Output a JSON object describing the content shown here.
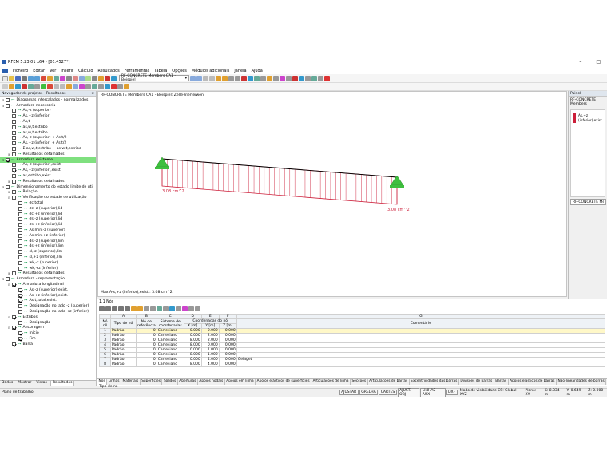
{
  "window": {
    "title": "RFEM 5.23.01 x64 - [01.4527*]"
  },
  "menu": [
    "Ficheiro",
    "Editar",
    "Ver",
    "Inserir",
    "Cálculo",
    "Resultados",
    "Ferramentas",
    "Tabela",
    "Opções",
    "Módulos adicionais",
    "Janela",
    "Ajuda"
  ],
  "toolbar": {
    "module_combo": "RF-CONCRETE Members CA1 - Beispiel"
  },
  "navigator": {
    "title": "Navegador de projetos - Resultados",
    "items": [
      {
        "level": 0,
        "toggle": "⊟",
        "checked": false,
        "label": "Diagramas intercalados - normalizados"
      },
      {
        "level": 0,
        "toggle": "⊟",
        "checked": false,
        "label": "Armadura necessária"
      },
      {
        "level": 1,
        "toggle": "",
        "checked": false,
        "label": "As,-z (superior)"
      },
      {
        "level": 1,
        "toggle": "",
        "checked": false,
        "label": "As,+z (inferior)"
      },
      {
        "level": 1,
        "toggle": "",
        "checked": false,
        "label": "As,t"
      },
      {
        "level": 1,
        "toggle": "",
        "checked": false,
        "label": "as,w,t,estribo"
      },
      {
        "level": 1,
        "toggle": "",
        "checked": false,
        "label": "as,w,t,estribo"
      },
      {
        "level": 1,
        "toggle": "",
        "checked": false,
        "label": "As,-z (superior) + As,t/2"
      },
      {
        "level": 1,
        "toggle": "",
        "checked": false,
        "label": "As,+z (inferior) + As,t/2"
      },
      {
        "level": 1,
        "toggle": "",
        "checked": false,
        "label": "Σ as,w,t,estribo + as,w,t,estribo"
      },
      {
        "level": 1,
        "toggle": "⊞",
        "checked": false,
        "label": "Resultados detalhados"
      },
      {
        "level": 0,
        "toggle": "⊟",
        "checked": true,
        "label": "Armadura existente",
        "highlight": true
      },
      {
        "level": 1,
        "toggle": "",
        "checked": false,
        "label": "As,-z (superior),exist."
      },
      {
        "level": 1,
        "toggle": "",
        "checked": true,
        "label": "As,+z (inferior),exist."
      },
      {
        "level": 1,
        "toggle": "",
        "checked": false,
        "label": "as,estribo,exist."
      },
      {
        "level": 1,
        "toggle": "⊞",
        "checked": false,
        "label": "Resultados detalhados"
      },
      {
        "level": 0,
        "toggle": "⊟",
        "checked": false,
        "label": "Dimensionamento do estado limite de uti"
      },
      {
        "level": 1,
        "toggle": "⊞",
        "checked": false,
        "label": "Relação"
      },
      {
        "level": 1,
        "toggle": "⊟",
        "checked": false,
        "label": "Verificação do estado de utilização"
      },
      {
        "level": 2,
        "toggle": "",
        "checked": false,
        "label": "σc,total"
      },
      {
        "level": 2,
        "toggle": "",
        "checked": false,
        "label": "σc,-z (superior),lid"
      },
      {
        "level": 2,
        "toggle": "",
        "checked": false,
        "label": "σc,+z (inferior),lid"
      },
      {
        "level": 2,
        "toggle": "",
        "checked": false,
        "label": "σs,-z (superior),lid"
      },
      {
        "level": 2,
        "toggle": "",
        "checked": false,
        "label": "σs,+z (inferior),lid"
      },
      {
        "level": 2,
        "toggle": "",
        "checked": false,
        "label": "As,min,-z (superior)"
      },
      {
        "level": 2,
        "toggle": "",
        "checked": false,
        "label": "As,min,+z (inferior)"
      },
      {
        "level": 2,
        "toggle": "",
        "checked": false,
        "label": "ds,-z (superior),lim"
      },
      {
        "level": 2,
        "toggle": "",
        "checked": false,
        "label": "ds,+z (inferior),lim"
      },
      {
        "level": 2,
        "toggle": "",
        "checked": false,
        "label": "sl,-z (superior),lim"
      },
      {
        "level": 2,
        "toggle": "",
        "checked": false,
        "label": "sl,+z (inferior),lim"
      },
      {
        "level": 2,
        "toggle": "",
        "checked": false,
        "label": "wk,-z (superior)"
      },
      {
        "level": 2,
        "toggle": "",
        "checked": false,
        "label": "wk,+z (inferior)"
      },
      {
        "level": 1,
        "toggle": "⊞",
        "checked": false,
        "label": "Resultados detalhados"
      },
      {
        "level": 0,
        "toggle": "⊟",
        "checked": false,
        "label": "Armadura - representação"
      },
      {
        "level": 1,
        "toggle": "⊟",
        "checked": true,
        "label": "Armadura longitudinal"
      },
      {
        "level": 2,
        "toggle": "",
        "checked": true,
        "label": "As,-z (superior),exist."
      },
      {
        "level": 2,
        "toggle": "",
        "checked": true,
        "label": "As,+z (inferior),exist."
      },
      {
        "level": 2,
        "toggle": "",
        "checked": true,
        "label": "As,t,total,exist."
      },
      {
        "level": 2,
        "toggle": "",
        "checked": false,
        "label": "Designação no lado -z (superior)"
      },
      {
        "level": 2,
        "toggle": "",
        "checked": false,
        "label": "Designação no lado +z (inferior)"
      },
      {
        "level": 1,
        "toggle": "⊟",
        "checked": true,
        "label": "Estribos"
      },
      {
        "level": 2,
        "toggle": "",
        "checked": false,
        "label": "Designação"
      },
      {
        "level": 1,
        "toggle": "⊟",
        "checked": true,
        "label": "Ancoragem"
      },
      {
        "level": 2,
        "toggle": "",
        "checked": true,
        "label": "Início"
      },
      {
        "level": 2,
        "toggle": "",
        "checked": true,
        "label": "Fim"
      },
      {
        "level": 1,
        "toggle": "",
        "checked": true,
        "label": "Barra"
      }
    ],
    "tabs": [
      "Dados",
      "Mostrar",
      "Vistas",
      "Resultados"
    ]
  },
  "viewport": {
    "title_line1": "RF-CONCRETE Members CA1 - Beispiel: Zelle-Vierteiwen",
    "left_label": "3.08 cm^2",
    "right_label": "3.08 cm^2",
    "max_text": "Max A-s,+z (inferior),exist.: 3.08 cm^2",
    "diagram_color": "#cc1f3a",
    "support_color": "#3fbf3f"
  },
  "panel": {
    "title": "Painel",
    "module": "RF-CONCRETE Members",
    "legend_label1": "As,+z",
    "legend_label2": "(inferior),exist.",
    "dropdown": "RF-CONCRETE Membr"
  },
  "table": {
    "title": "1.1 Nós",
    "col_letters": [
      "A",
      "B",
      "C",
      "D",
      "E",
      "F",
      "G"
    ],
    "headers": {
      "no": "Nó nº",
      "tipo": "Tipo de nó",
      "ref": "Nó de referência",
      "sys": "Sistema de coordenadas",
      "coords": "Coordenadas do nó",
      "x": "X [m]",
      "y": "Y [m]",
      "z": "Z [m]",
      "comment": "Comentário"
    },
    "rows": [
      {
        "no": "1",
        "tipo": "Padrão",
        "ref": "0",
        "sys": "Cartesiano",
        "x": "0.000",
        "y": "0.000",
        "z": "0.000",
        "comment": ""
      },
      {
        "no": "2",
        "tipo": "Padrão",
        "ref": "0",
        "sys": "Cartesiano",
        "x": "0.000",
        "y": "2.000",
        "z": "0.000",
        "comment": ""
      },
      {
        "no": "3",
        "tipo": "Padrão",
        "ref": "0",
        "sys": "Cartesiano",
        "x": "8.000",
        "y": "2.000",
        "z": "0.000",
        "comment": ""
      },
      {
        "no": "4",
        "tipo": "Padrão",
        "ref": "0",
        "sys": "Cartesiano",
        "x": "8.000",
        "y": "0.000",
        "z": "0.000",
        "comment": ""
      },
      {
        "no": "5",
        "tipo": "Padrão",
        "ref": "0",
        "sys": "Cartesiano",
        "x": "0.000",
        "y": "1.000",
        "z": "0.000",
        "comment": ""
      },
      {
        "no": "6",
        "tipo": "Padrão",
        "ref": "0",
        "sys": "Cartesiano",
        "x": "8.000",
        "y": "1.000",
        "z": "0.000",
        "comment": ""
      },
      {
        "no": "7",
        "tipo": "Padrão",
        "ref": "0",
        "sys": "Cartesiano",
        "x": "0.000",
        "y": "4.000",
        "z": "0.000",
        "comment": "Gelaget"
      },
      {
        "no": "8",
        "tipo": "Padrão",
        "ref": "0",
        "sys": "Cartesiano",
        "x": "8.000",
        "y": "4.000",
        "z": "0.000",
        "comment": ""
      }
    ],
    "bottom_tabs": [
      "Nós",
      "Linhas",
      "Materiais",
      "Superfícies",
      "Sólidos",
      "Aberturas",
      "Apoios nodais",
      "Apoios em linha",
      "Apoios elásticos de superfícies",
      "Articulações de linha",
      "Secções",
      "Articulações de barras",
      "Excentricidades das barras",
      "Divisões de barras",
      "Barras",
      "Apoios elásticos de barras",
      "Não-linearidades de barras",
      "Conjuntos de barras"
    ],
    "footer": "Tipo de nó"
  },
  "status": {
    "left": "Plano de trabalho",
    "buttons": [
      "AJUSTAR",
      "GRELHA",
      "CARTES",
      "AJUST. OBJ",
      "LINHAS AUX",
      "DXF"
    ],
    "info1": "Modo de visibilidade CS: Global XYZ",
    "info2": "Plano: XY",
    "info3": "X: 8.334 m",
    "info4": "Y: 0.649 m",
    "info5": "Z: 0.000 m"
  }
}
